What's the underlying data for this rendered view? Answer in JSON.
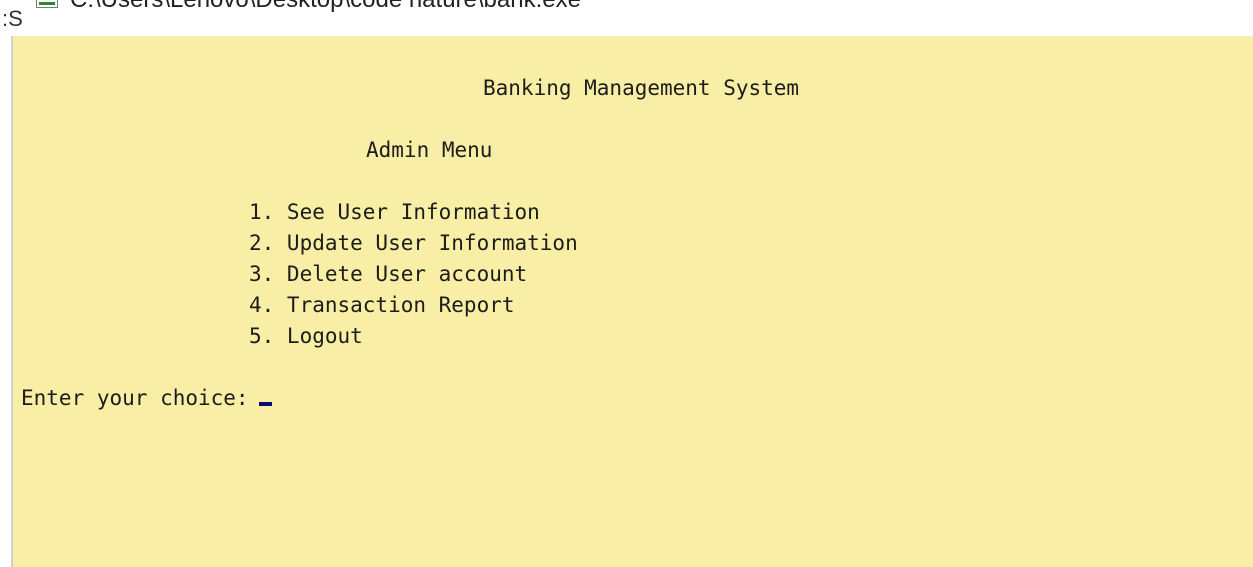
{
  "window": {
    "title": "C:\\Users\\Lenovo\\Desktop\\code nature\\bank.exe",
    "left_edge_text": ":S"
  },
  "console": {
    "heading": "Banking Management System",
    "menu_title": "Admin Menu",
    "menu_items": [
      "1. See User Information",
      "2. Update User Information",
      "3. Delete User account",
      "4. Transaction Report",
      "5. Logout"
    ],
    "prompt": "Enter your choice:"
  },
  "colors": {
    "console_background": "#f8eea5",
    "console_text": "#1c1c1c",
    "cursor": "#0a0a6b"
  }
}
